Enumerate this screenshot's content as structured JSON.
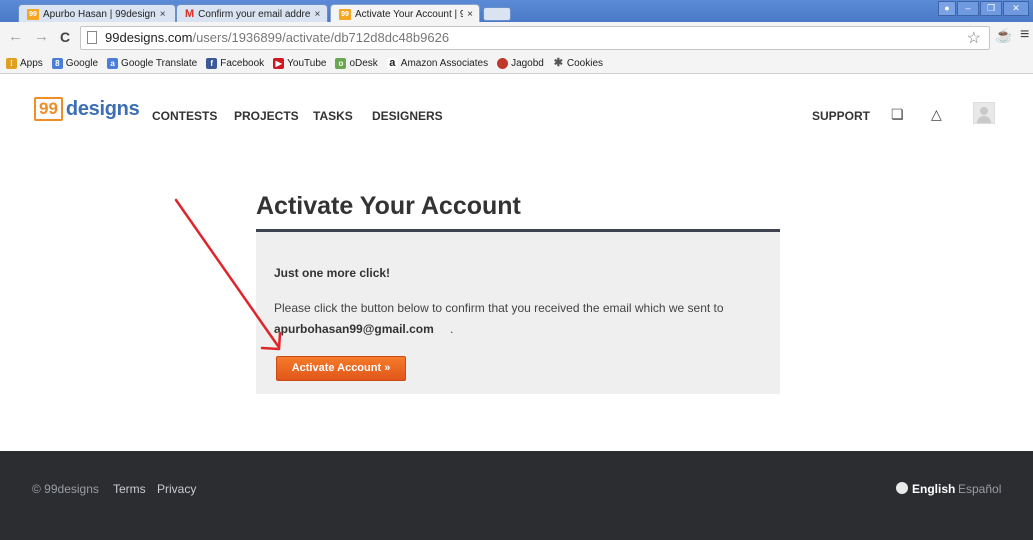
{
  "browser": {
    "tabs": [
      {
        "title": "Apurbo Hasan | 99design",
        "favicon": "99designs-icon"
      },
      {
        "title": "Confirm your email addre",
        "favicon": "gmail-icon"
      },
      {
        "title": "Activate Your Account | 9",
        "favicon": "99designs-icon",
        "active": true
      }
    ],
    "tab_close": "×",
    "url_host": "99designs.com",
    "url_path": "/users/1936899/activate/db712d8dc48b9626",
    "bookmarks": [
      {
        "label": "Apps",
        "icon": "apps-grid-icon",
        "color": "#e0a020"
      },
      {
        "label": "Google",
        "icon": "google-icon",
        "color": "#4a7ed8"
      },
      {
        "label": "Google Translate",
        "icon": "translate-icon",
        "color": "#4a7ed8"
      },
      {
        "label": "Facebook",
        "icon": "facebook-icon",
        "color": "#3b5998"
      },
      {
        "label": "YouTube",
        "icon": "youtube-icon",
        "color": "#cc181e"
      },
      {
        "label": "oDesk",
        "icon": "odesk-icon",
        "color": "#6aa84f"
      },
      {
        "label": "Amazon Associates",
        "icon": "amazon-icon",
        "color": "#222222"
      },
      {
        "label": "Jagobd",
        "icon": "jagobd-icon",
        "color": "#c0392b"
      },
      {
        "label": "Cookies",
        "icon": "cookie-icon",
        "color": "#555555"
      }
    ]
  },
  "header": {
    "logo_num": "99",
    "logo_word": "designs",
    "nav": [
      "CONTESTS",
      "PROJECTS",
      "TASKS",
      "DESIGNERS"
    ],
    "support": "SUPPORT"
  },
  "main": {
    "heading": "Activate Your Account",
    "subheading": "Just one more click!",
    "body": "Please click the button below to confirm that you received the email which we sent to",
    "email": "apurbohasan99@gmail.com",
    "email_suffix": ".",
    "button": "Activate Account »"
  },
  "footer": {
    "copyright": "© 99designs",
    "terms": "Terms",
    "privacy": "Privacy",
    "lang_current": "English",
    "lang_other": "Español"
  },
  "colors": {
    "accent_orange": "#f0652a",
    "footer_bg": "#2b2d31",
    "arrow": "#e0252a"
  }
}
